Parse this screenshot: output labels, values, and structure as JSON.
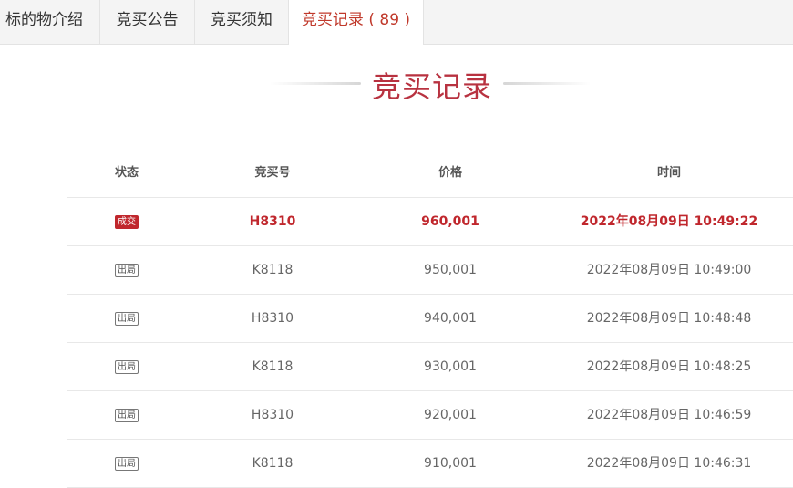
{
  "tabs": [
    {
      "label": "标的物介绍"
    },
    {
      "label": "竞买公告"
    },
    {
      "label": "竞买须知"
    },
    {
      "label": "竞买记录 ( 89 )"
    }
  ],
  "section_title": "竞买记录",
  "table": {
    "headers": {
      "status": "状态",
      "bidder": "竞买号",
      "price": "价格",
      "time": "时间"
    },
    "rows": [
      {
        "status": "成交",
        "bidder": "H8310",
        "price": "960,001",
        "time": "2022年08月09日 10:49:22"
      },
      {
        "status": "出局",
        "bidder": "K8118",
        "price": "950,001",
        "time": "2022年08月09日 10:49:00"
      },
      {
        "status": "出局",
        "bidder": "H8310",
        "price": "940,001",
        "time": "2022年08月09日 10:48:48"
      },
      {
        "status": "出局",
        "bidder": "K8118",
        "price": "930,001",
        "time": "2022年08月09日 10:48:25"
      },
      {
        "status": "出局",
        "bidder": "H8310",
        "price": "920,001",
        "time": "2022年08月09日 10:46:59"
      },
      {
        "status": "出局",
        "bidder": "K8118",
        "price": "910,001",
        "time": "2022年08月09日 10:46:31"
      }
    ]
  },
  "colors": {
    "accent": "#c0272d",
    "title": "#b83240"
  }
}
